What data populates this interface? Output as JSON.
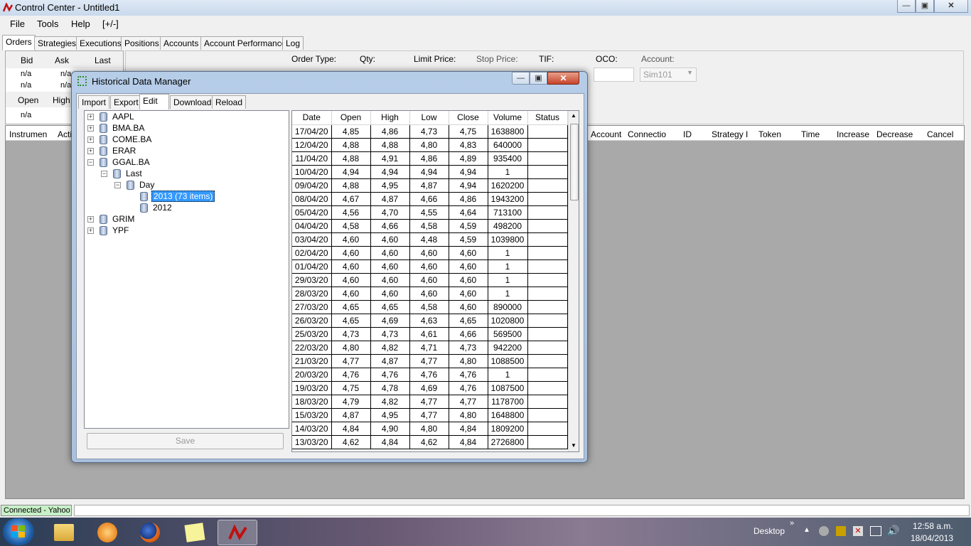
{
  "window": {
    "title": "Control Center - Untitled1"
  },
  "menu": [
    "File",
    "Tools",
    "Help",
    "[+/-]"
  ],
  "tabs": [
    "Orders",
    "Strategies",
    "Executions",
    "Positions",
    "Accounts",
    "Account Performance",
    "Log"
  ],
  "quote": {
    "headers1": [
      "Bid",
      "Ask",
      "Last"
    ],
    "row1": [
      "n/a",
      "n/a"
    ],
    "row2": [
      "n/a",
      "n/a"
    ],
    "headers2": [
      "Open",
      "High"
    ],
    "row3": [
      "n/a"
    ]
  },
  "order_form": {
    "labels": [
      "Order Type:",
      "Qty:",
      "Limit Price:",
      "Stop Price:",
      "TIF:",
      "OCO:",
      "Account:"
    ],
    "account_value": "Sim101"
  },
  "orders_grid": {
    "headers_left": [
      "Instrumen",
      "Acti"
    ],
    "headers_right": [
      "Account",
      "Connectio",
      "ID",
      "Strategy I",
      "Token",
      "Time",
      "Increase",
      "Decrease",
      "Cancel"
    ]
  },
  "status": {
    "connection": "Connected - Yahoo"
  },
  "taskbar": {
    "desktop_label": "Desktop",
    "chevron": "»",
    "time": "12:58 a.m.",
    "date": "18/04/2013"
  },
  "dialog": {
    "title": "Historical Data Manager",
    "tabs": [
      "Import",
      "Export",
      "Edit",
      "Download",
      "Reload"
    ],
    "save_label": "Save",
    "tree": {
      "aapl": "AAPL",
      "bma": "BMA.BA",
      "come": "COME.BA",
      "erar": "ERAR",
      "ggal": "GGAL.BA",
      "last": "Last",
      "day": "Day",
      "y2013": "2013 (73 items)",
      "y2012": "2012",
      "grim": "GRIM",
      "ypf": "YPF"
    },
    "columns": [
      "Date",
      "Open",
      "High",
      "Low",
      "Close",
      "Volume",
      "Status"
    ],
    "rows": [
      [
        "17/04/20",
        "4,85",
        "4,86",
        "4,73",
        "4,75",
        "1638800",
        ""
      ],
      [
        "12/04/20",
        "4,88",
        "4,88",
        "4,80",
        "4,83",
        "640000",
        ""
      ],
      [
        "11/04/20",
        "4,88",
        "4,91",
        "4,86",
        "4,89",
        "935400",
        ""
      ],
      [
        "10/04/20",
        "4,94",
        "4,94",
        "4,94",
        "4,94",
        "1",
        ""
      ],
      [
        "09/04/20",
        "4,88",
        "4,95",
        "4,87",
        "4,94",
        "1620200",
        ""
      ],
      [
        "08/04/20",
        "4,67",
        "4,87",
        "4,66",
        "4,86",
        "1943200",
        ""
      ],
      [
        "05/04/20",
        "4,56",
        "4,70",
        "4,55",
        "4,64",
        "713100",
        ""
      ],
      [
        "04/04/20",
        "4,58",
        "4,66",
        "4,58",
        "4,59",
        "498200",
        ""
      ],
      [
        "03/04/20",
        "4,60",
        "4,60",
        "4,48",
        "4,59",
        "1039800",
        ""
      ],
      [
        "02/04/20",
        "4,60",
        "4,60",
        "4,60",
        "4,60",
        "1",
        ""
      ],
      [
        "01/04/20",
        "4,60",
        "4,60",
        "4,60",
        "4,60",
        "1",
        ""
      ],
      [
        "29/03/20",
        "4,60",
        "4,60",
        "4,60",
        "4,60",
        "1",
        ""
      ],
      [
        "28/03/20",
        "4,60",
        "4,60",
        "4,60",
        "4,60",
        "1",
        ""
      ],
      [
        "27/03/20",
        "4,65",
        "4,65",
        "4,58",
        "4,60",
        "890000",
        ""
      ],
      [
        "26/03/20",
        "4,65",
        "4,69",
        "4,63",
        "4,65",
        "1020800",
        ""
      ],
      [
        "25/03/20",
        "4,73",
        "4,73",
        "4,61",
        "4,66",
        "569500",
        ""
      ],
      [
        "22/03/20",
        "4,80",
        "4,82",
        "4,71",
        "4,73",
        "942200",
        ""
      ],
      [
        "21/03/20",
        "4,77",
        "4,87",
        "4,77",
        "4,80",
        "1088500",
        ""
      ],
      [
        "20/03/20",
        "4,76",
        "4,76",
        "4,76",
        "4,76",
        "1",
        ""
      ],
      [
        "19/03/20",
        "4,75",
        "4,78",
        "4,69",
        "4,76",
        "1087500",
        ""
      ],
      [
        "18/03/20",
        "4,79",
        "4,82",
        "4,77",
        "4,77",
        "1178700",
        ""
      ],
      [
        "15/03/20",
        "4,87",
        "4,95",
        "4,77",
        "4,80",
        "1648800",
        ""
      ],
      [
        "14/03/20",
        "4,84",
        "4,90",
        "4,80",
        "4,84",
        "1809200",
        ""
      ],
      [
        "13/03/20",
        "4,62",
        "4,84",
        "4,62",
        "4,84",
        "2726800",
        ""
      ]
    ]
  },
  "colors": {
    "selection": "#3399ff",
    "status_ok": "#c8f0c8",
    "gray_area": "#a9a9a9"
  }
}
